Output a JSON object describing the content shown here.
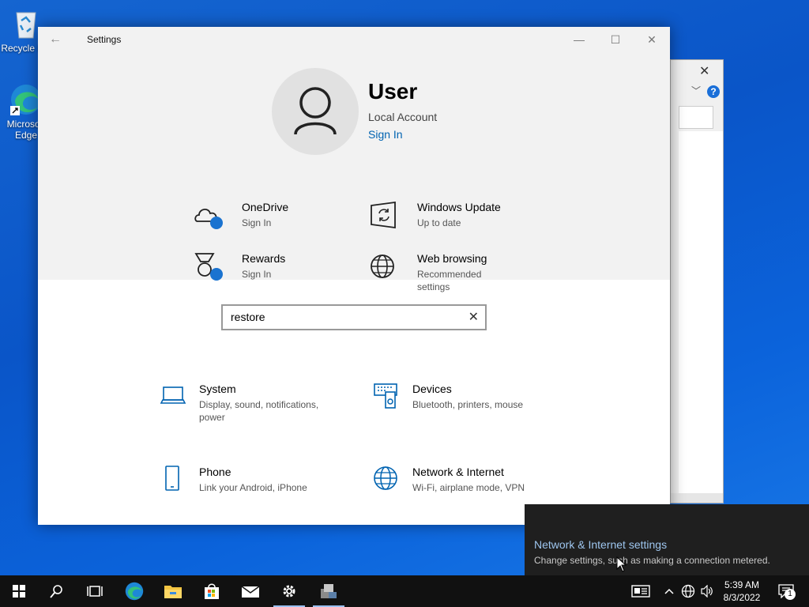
{
  "desktop": {
    "icons": [
      {
        "label": "Recycle Bin",
        "icon": "recycle-bin-icon"
      },
      {
        "label": "Microsoft Edge",
        "icon": "edge-icon"
      }
    ]
  },
  "background_window": {
    "close": "✕",
    "help": "?",
    "chevron": "﹀"
  },
  "settings": {
    "title": "Settings",
    "back": "←",
    "controls": {
      "minimize": "—",
      "maximize": "☐",
      "close": "✕"
    },
    "user": {
      "name": "User",
      "account": "Local Account",
      "link": "Sign In"
    },
    "tiles": [
      {
        "title": "OneDrive",
        "sub": "Sign In",
        "icon": "cloud-icon"
      },
      {
        "title": "Windows Update",
        "sub": "Up to date",
        "icon": "windows-update-icon"
      },
      {
        "title": "Rewards",
        "sub": "Sign In",
        "icon": "medal-icon"
      },
      {
        "title": "Web browsing",
        "sub": "Recommended settings",
        "icon": "globe-icon"
      }
    ],
    "search": {
      "value": "restore",
      "clear": "✕"
    },
    "categories": [
      {
        "title": "System",
        "sub": "Display, sound, notifications, power",
        "icon": "laptop-icon"
      },
      {
        "title": "Devices",
        "sub": "Bluetooth, printers, mouse",
        "icon": "devices-icon"
      },
      {
        "title": "Phone",
        "sub": "Link your Android, iPhone",
        "icon": "phone-icon"
      },
      {
        "title": "Network & Internet",
        "sub": "Wi-Fi, airplane mode, VPN",
        "icon": "network-globe-icon"
      }
    ]
  },
  "toast": {
    "title": "Network & Internet settings",
    "body": "Change settings, such as making a connection metered."
  },
  "taskbar": {
    "items": [
      "start-icon",
      "search-icon",
      "task-view-icon",
      "edge-icon",
      "file-explorer-icon",
      "store-icon",
      "mail-icon",
      "settings-gear-icon",
      "app-installer-icon"
    ],
    "clock": {
      "time": "5:39 AM",
      "date": "8/3/2022"
    },
    "notification_count": "1"
  }
}
